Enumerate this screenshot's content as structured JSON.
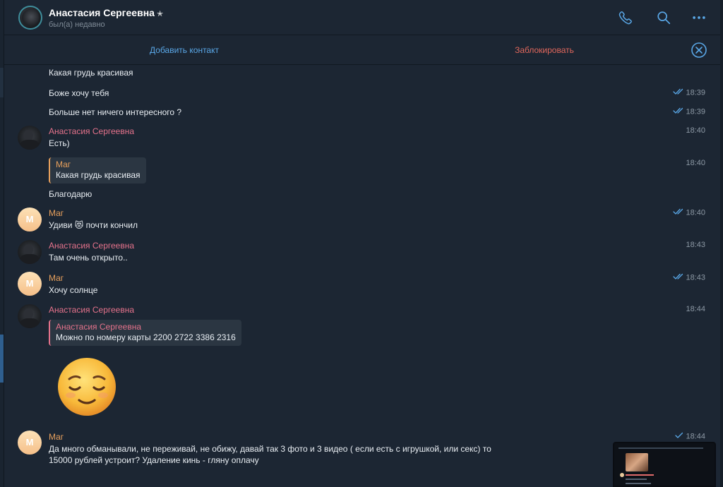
{
  "header": {
    "name": "Анастасия Сергеевна",
    "star": "✭",
    "status": "был(а) недавно",
    "icons": [
      "phone-icon",
      "search-icon",
      "more-icon"
    ]
  },
  "actionbar": {
    "add_label": "Добавить контакт",
    "block_label": "Заблокировать"
  },
  "colors": {
    "accent": "#5aa8e8",
    "danger": "#e0675c",
    "sender_pink": "#e4728b",
    "sender_orange": "#e8a05c",
    "background": "#1c2633"
  },
  "messages": [
    {
      "text": "Какая грудь красивая"
    },
    {
      "text": "Боже хочу тебя",
      "time": "18:39",
      "read": true
    },
    {
      "text": "Больше нет ничего интересного ?",
      "time": "18:39",
      "read": true
    },
    {
      "sender": "Анастасия Сергеевна",
      "text": "Есть)",
      "time": "18:40"
    },
    {
      "reply_to": {
        "name": "Маг",
        "text": "Какая грудь красивая"
      },
      "time": "18:40"
    },
    {
      "text": "Благодарю"
    },
    {
      "sender": "Маг",
      "avatar_letter": "М",
      "text": "Удиви 😻 почти кончил",
      "time": "18:40",
      "read": true
    },
    {
      "sender": "Анастасия Сергеевна",
      "text": "Там очень открыто..",
      "time": "18:43"
    },
    {
      "sender": "Маг",
      "avatar_letter": "М",
      "text": "Хочу солнце",
      "time": "18:43",
      "read": true
    },
    {
      "sender": "Анастасия Сергеевна",
      "reply_to": {
        "name": "Анастасия Сергеевна",
        "text": "Можно по номеру карты   2200 2722 3386 2316"
      },
      "time": "18:44",
      "sticker": "relieved-face"
    },
    {
      "sender": "Маг",
      "avatar_letter": "М",
      "text": "Да много обманывали, не переживай, не обижу, давай так 3 фото и 3 видео ( если есть с игрушкой, или секс) то 15000 рублей устроит? Удаление кинь - гляну оплачу",
      "time": "18:44",
      "read": false,
      "sent": true
    }
  ]
}
